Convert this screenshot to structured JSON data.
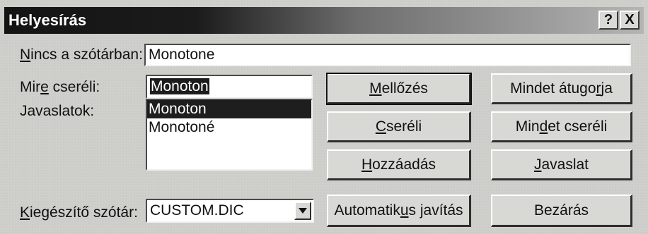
{
  "window": {
    "title": "Helyesírás",
    "help_label": "?",
    "close_label": "X"
  },
  "not_in_dictionary": {
    "label_pre": "",
    "label_accel": "N",
    "label_post": "incs a szótárban:",
    "value": "Monotone"
  },
  "change_to": {
    "label_pre": "Mir",
    "label_accel": "e",
    "label_post": " cseréli:",
    "value": "Monoton"
  },
  "suggestions": {
    "label": "Javaslatok:",
    "items": [
      "Monoton",
      "Monotoné"
    ],
    "selected_index": 0
  },
  "custom_dictionary": {
    "label_pre": "",
    "label_accel": "K",
    "label_post": "iegészítő szótár:",
    "value": "CUSTOM.DIC"
  },
  "buttons": {
    "ignore": {
      "pre": "",
      "accel": "M",
      "post": "ellőzés"
    },
    "ignore_all": {
      "pre": "Mindet átugo",
      "accel": "r",
      "post": "ja"
    },
    "change": {
      "pre": "",
      "accel": "C",
      "post": "seréli"
    },
    "change_all": {
      "pre": "Min",
      "accel": "d",
      "post": "et cseréli"
    },
    "add": {
      "pre": "",
      "accel": "H",
      "post": "ozzáadás"
    },
    "suggest": {
      "pre": "",
      "accel": "J",
      "post": "avaslat"
    },
    "autocorrect": {
      "pre": "Automatik",
      "accel": "u",
      "post": "s javítás"
    },
    "close": {
      "pre": "",
      "accel": "",
      "post": "Bezárás"
    }
  },
  "icons": {
    "dropdown": "triangle-down-icon"
  }
}
